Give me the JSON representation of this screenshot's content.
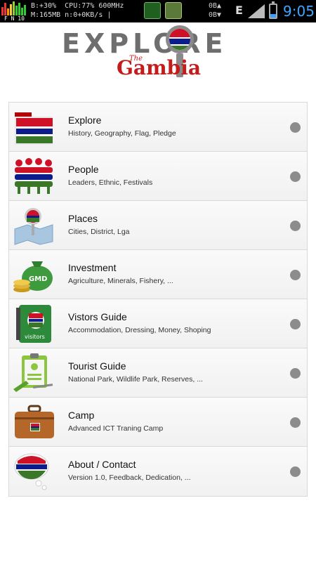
{
  "status_bar": {
    "stats_line1": "B:+30%  CPU:77% 600MHz",
    "stats_line2": "M:165MB n:0+0KB/s |",
    "flags": "F N 10",
    "net_line1": "0B▲",
    "net_line2": "0B▼",
    "network_type": "E",
    "time": "9:05",
    "battery_level": 0.3
  },
  "logo": {
    "word1": "EXPLORE",
    "word_the": "The",
    "word2": "Gambia"
  },
  "menu": [
    {
      "title": "Explore",
      "subtitle": "History, Geography, Flag, Pledge",
      "icon": "flag-folder-icon"
    },
    {
      "title": "People",
      "subtitle": "Leaders, Ethnic, Festivals",
      "icon": "people-group-icon"
    },
    {
      "title": "Places",
      "subtitle": "Cities, District, Lga",
      "icon": "map-pin-icon"
    },
    {
      "title": "Investment",
      "subtitle": "Agriculture, Minerals, Fishery, ...",
      "icon": "money-bag-icon"
    },
    {
      "title": "Vistors Guide",
      "subtitle": "Accommodation, Dressing, Money, Shoping",
      "icon": "visitors-book-icon"
    },
    {
      "title": "Tourist Guide",
      "subtitle": "National Park, Wildlife Park, Reserves, ...",
      "icon": "clipboard-icon"
    },
    {
      "title": "Camp",
      "subtitle": "Advanced ICT Traning Camp",
      "icon": "suitcase-icon"
    },
    {
      "title": "About / Contact",
      "subtitle": "Version 1.0, Feedback, Dedication, ...",
      "icon": "speech-bubble-icon"
    }
  ],
  "colors": {
    "flag_red": "#ce1126",
    "flag_blue": "#0c1c8c",
    "flag_green": "#3a7728",
    "time_blue": "#3ea6ff",
    "logo_red": "#c51b1b"
  },
  "icon_glyphs": {
    "money_bag_label": "GMD",
    "visitors_label": "visitors"
  }
}
